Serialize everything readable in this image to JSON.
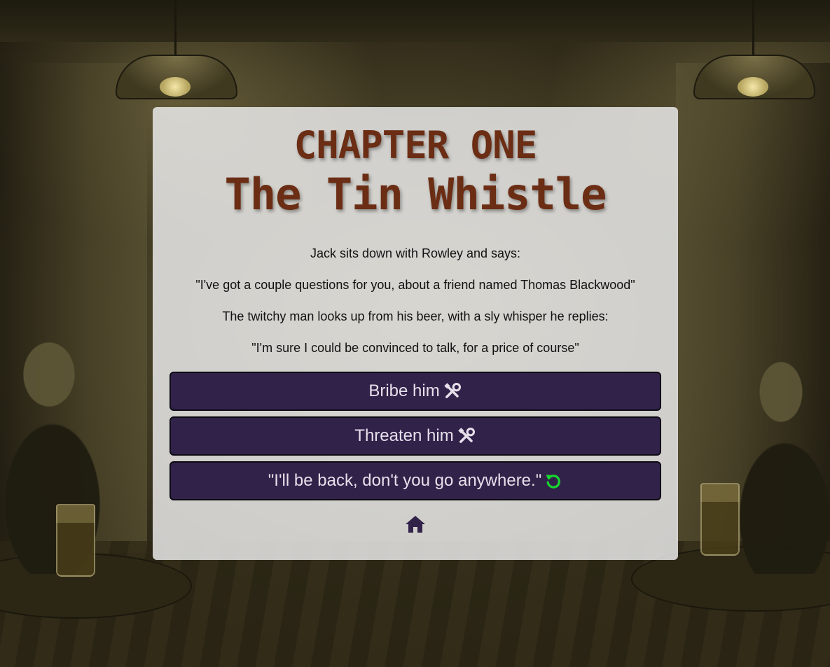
{
  "chapter": {
    "number_label": "CHAPTER ONE",
    "title": "The Tin Whistle"
  },
  "story": {
    "paragraphs": [
      "Jack sits down with Rowley and says:",
      "\"I've got a couple questions for you, about a friend named Thomas Blackwood\"",
      "The twitchy man looks up from his beer, with a sly whisper he replies:",
      "\"I'm sure I could be convinced to talk, for a price of course\""
    ]
  },
  "choices": [
    {
      "label": "Bribe him",
      "icon": "tools-icon",
      "icon_color": "#e6e0ea"
    },
    {
      "label": "Threaten him",
      "icon": "tools-icon",
      "icon_color": "#e6e0ea"
    },
    {
      "label": "\"I'll be back, don't you go anywhere.\"",
      "icon": "restart-icon",
      "icon_color": "#17d62f"
    }
  ],
  "home": {
    "icon": "home-icon",
    "color": "#31224a"
  },
  "colors": {
    "title": "#6b2d14",
    "button_bg": "#31224a",
    "button_text": "#e6e0ea",
    "card_bg": "#ececec"
  }
}
